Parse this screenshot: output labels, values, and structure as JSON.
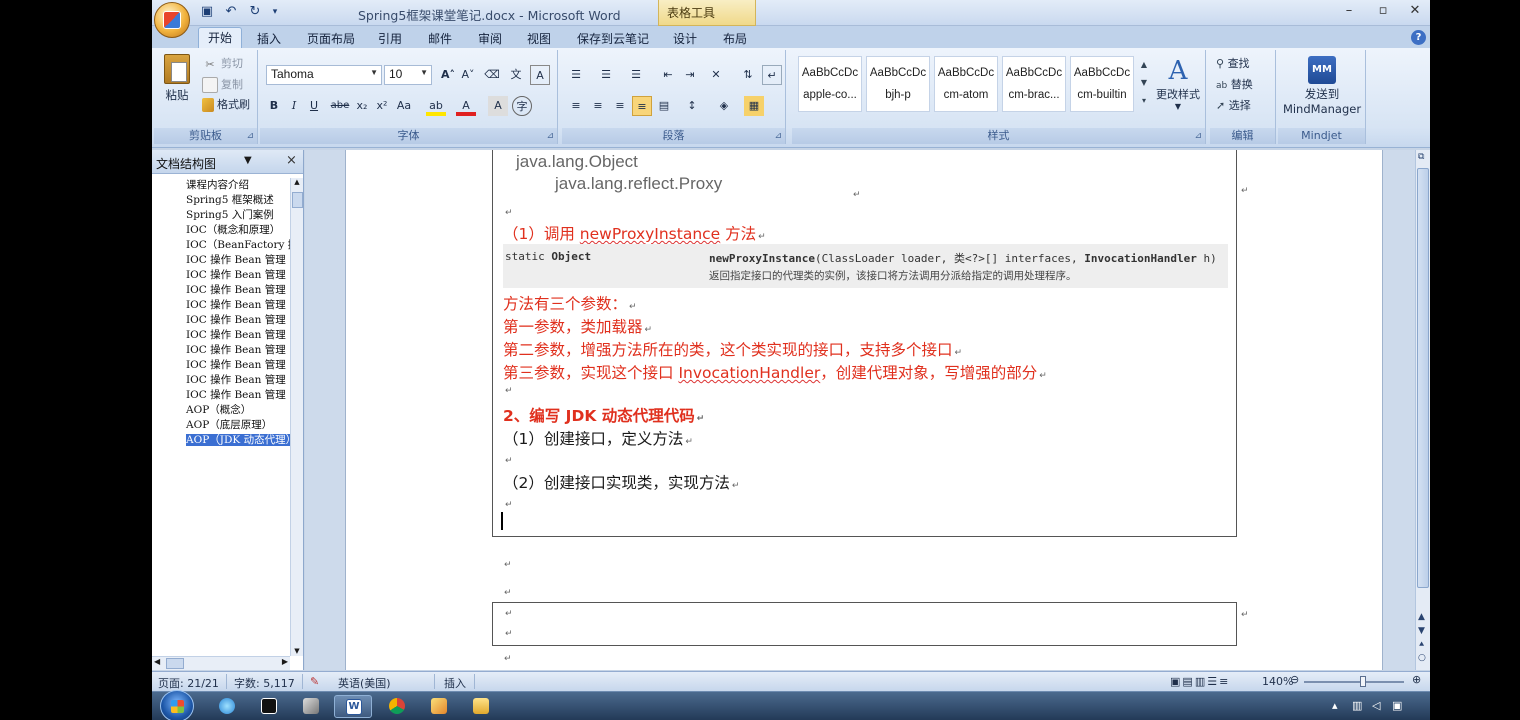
{
  "window": {
    "title": "Spring5框架课堂笔记.docx - Microsoft Word",
    "context_tab": "表格工具",
    "controls": [
      "–",
      "▫",
      "✕"
    ]
  },
  "ribbon": {
    "tabs": [
      "开始",
      "插入",
      "页面布局",
      "引用",
      "邮件",
      "审阅",
      "视图",
      "保存到云笔记",
      "设计",
      "布局"
    ],
    "active_tab": "开始",
    "clipboard": {
      "paste": "粘贴",
      "cut": "剪切",
      "copy": "复制",
      "format_painter": "格式刷",
      "label": "剪贴板"
    },
    "font": {
      "family": "Tahoma",
      "size": "10",
      "label": "字体"
    },
    "paragraph": {
      "label": "段落"
    },
    "styles": {
      "label": "样式",
      "items": [
        {
          "sample": "AaBbCcDc",
          "name": "apple-co..."
        },
        {
          "sample": "AaBbCcDc",
          "name": "bjh-p"
        },
        {
          "sample": "AaBbCcDc",
          "name": "cm-atom"
        },
        {
          "sample": "AaBbCcDc",
          "name": "cm-brac..."
        },
        {
          "sample": "AaBbCcDc",
          "name": "cm-builtin"
        }
      ],
      "change_styles": "更改样式"
    },
    "editing": {
      "find": "查找",
      "replace": "替换",
      "select": "选择",
      "label": "编辑"
    },
    "mindjet": {
      "send_line1": "发送到",
      "send_line2": "MindManager",
      "label": "Mindjet"
    }
  },
  "nav_pane": {
    "title": "文档结构图",
    "items": [
      "课程内容介绍",
      "Spring5 框架概述",
      "Spring5 入门案例",
      "IOC（概念和原理）",
      "IOC（BeanFactory 接",
      "IOC 操作 Bean 管理（",
      "IOC 操作 Bean 管理（",
      "IOC 操作 Bean 管理（",
      "IOC 操作 Bean 管理（",
      "IOC 操作 Bean 管理（",
      "IOC 操作 Bean 管理（",
      "IOC 操作 Bean 管理（",
      "IOC 操作 Bean 管理（",
      "IOC 操作 Bean 管理（",
      "IOC 操作 Bean 管理（",
      "AOP（概念）",
      "AOP（底层原理）",
      "AOP（JDK 动态代理）"
    ],
    "selected_index": 17
  },
  "document": {
    "class_line1": "java.lang.Object",
    "class_line2": "java.lang.reflect.Proxy",
    "step1_prefix": "（1）调用 ",
    "step1_method": "newProxyInstance",
    "step1_suffix": " 方法",
    "api_modifier": "static ",
    "api_type": "Object",
    "api_sig_name": "newProxyInstance",
    "api_sig_args": "(ClassLoader loader, 类<?>[] interfaces, ",
    "api_sig_handler": "InvocationHandler",
    "api_sig_end": " h)",
    "api_desc": "返回指定接口的代理类的实例，该接口将方法调用分派给指定的调用处理程序。",
    "param_intro": "方法有三个参数：",
    "param1": "第一参数，类加载器",
    "param2": "第二参数，增强方法所在的类，这个类实现的接口，支持多个接口",
    "param3_prefix": "第三参数，实现这个接口 ",
    "param3_iface": "InvocationHandler",
    "param3_suffix": "，创建代理对象，写增强的部分",
    "heading2": "2、编写 JDK 动态代理代码",
    "sub1": "（1）创建接口，定义方法",
    "sub2": "（2）创建接口实现类，实现方法"
  },
  "status_bar": {
    "page": "页面: 21/21",
    "words": "字数: 5,117",
    "language": "英语(美国)",
    "mode": "插入",
    "zoom": "140%"
  }
}
